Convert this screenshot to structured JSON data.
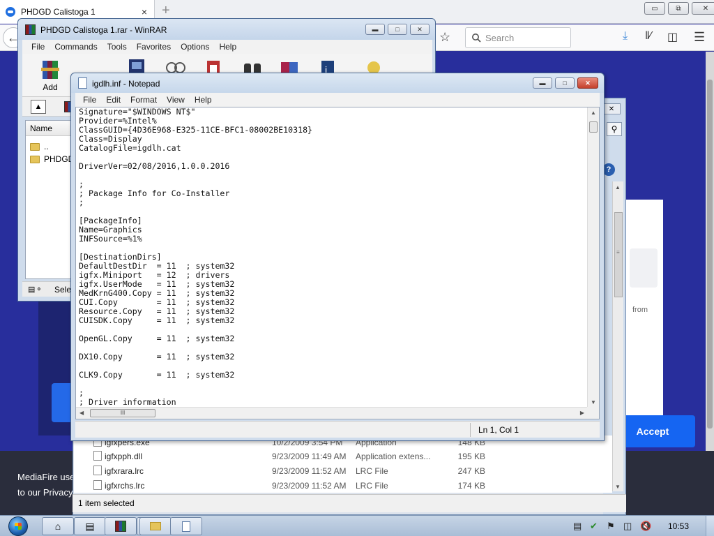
{
  "browser": {
    "tab_title": "PHDGD Calistoga 1",
    "tab_close": "×",
    "new_tab": "+",
    "search_placeholder": "Search",
    "window_controls": {
      "minimize": "▭",
      "maximize": "⧉",
      "close": "✕"
    },
    "page": {
      "cookie_line1": "MediaFire use",
      "cookie_line2": "to our Privacy",
      "accept_label": "Accept",
      "side_text": "from"
    }
  },
  "winrar": {
    "title": "PHDGD Calistoga 1.rar - WinRAR",
    "menu": [
      "File",
      "Commands",
      "Tools",
      "Favorites",
      "Options",
      "Help"
    ],
    "toolbar": {
      "add_label": "Add"
    },
    "column_name": "Name",
    "rows": [
      "..",
      "PHDGD"
    ],
    "status_text": "Sele"
  },
  "notepad": {
    "title": "igdlh.inf - Notepad",
    "menu": [
      "File",
      "Edit",
      "Format",
      "View",
      "Help"
    ],
    "text": "Signature=\"$WINDOWS NT$\"\nProvider=%Intel%\nClassGUID={4D36E968-E325-11CE-BFC1-08002BE10318}\nClass=Display\nCatalogFile=igdlh.cat\n\nDriverVer=02/08/2016,1.0.0.2016\n\n;\n; Package Info for Co-Installer\n;\n\n[PackageInfo]\nName=Graphics\nINFSource=%1%\n\n[DestinationDirs]\nDefaultDestDir  = 11  ; system32\nigfx.Miniport   = 12  ; drivers\nigfx.UserMode   = 11  ; system32\nMedKrnG400.Copy = 11  ; system32\nCUI.Copy        = 11  ; system32\nResource.Copy   = 11  ; system32\nCUISDK.Copy     = 11  ; system32\n\nOpenGL.Copy     = 11  ; system32\n\nDX10.Copy       = 11  ; system32\n\nCLK9.Copy       = 11  ; system32\n\n;\n; Driver information",
    "status_position": "Ln 1, Col 1"
  },
  "file_list": {
    "rows": [
      {
        "name": "igfxpers.exe",
        "date": "10/2/2009 3:54 PM",
        "type": "Application",
        "size": "148 KB"
      },
      {
        "name": "igfxpph.dll",
        "date": "9/23/2009 11:49 AM",
        "type": "Application extens...",
        "size": "195 KB"
      },
      {
        "name": "igfxrara.lrc",
        "date": "9/23/2009 11:52 AM",
        "type": "LRC File",
        "size": "247 KB"
      },
      {
        "name": "igfxrchs.lrc",
        "date": "9/23/2009 11:52 AM",
        "type": "LRC File",
        "size": "174 KB"
      }
    ],
    "status": "1 item selected"
  },
  "taskbar": {
    "clock": "10:53"
  },
  "colors": {
    "page_background": "#2b2f9a",
    "accept_button": "#1565f2",
    "cookie_bar": "#2a2d3c"
  }
}
